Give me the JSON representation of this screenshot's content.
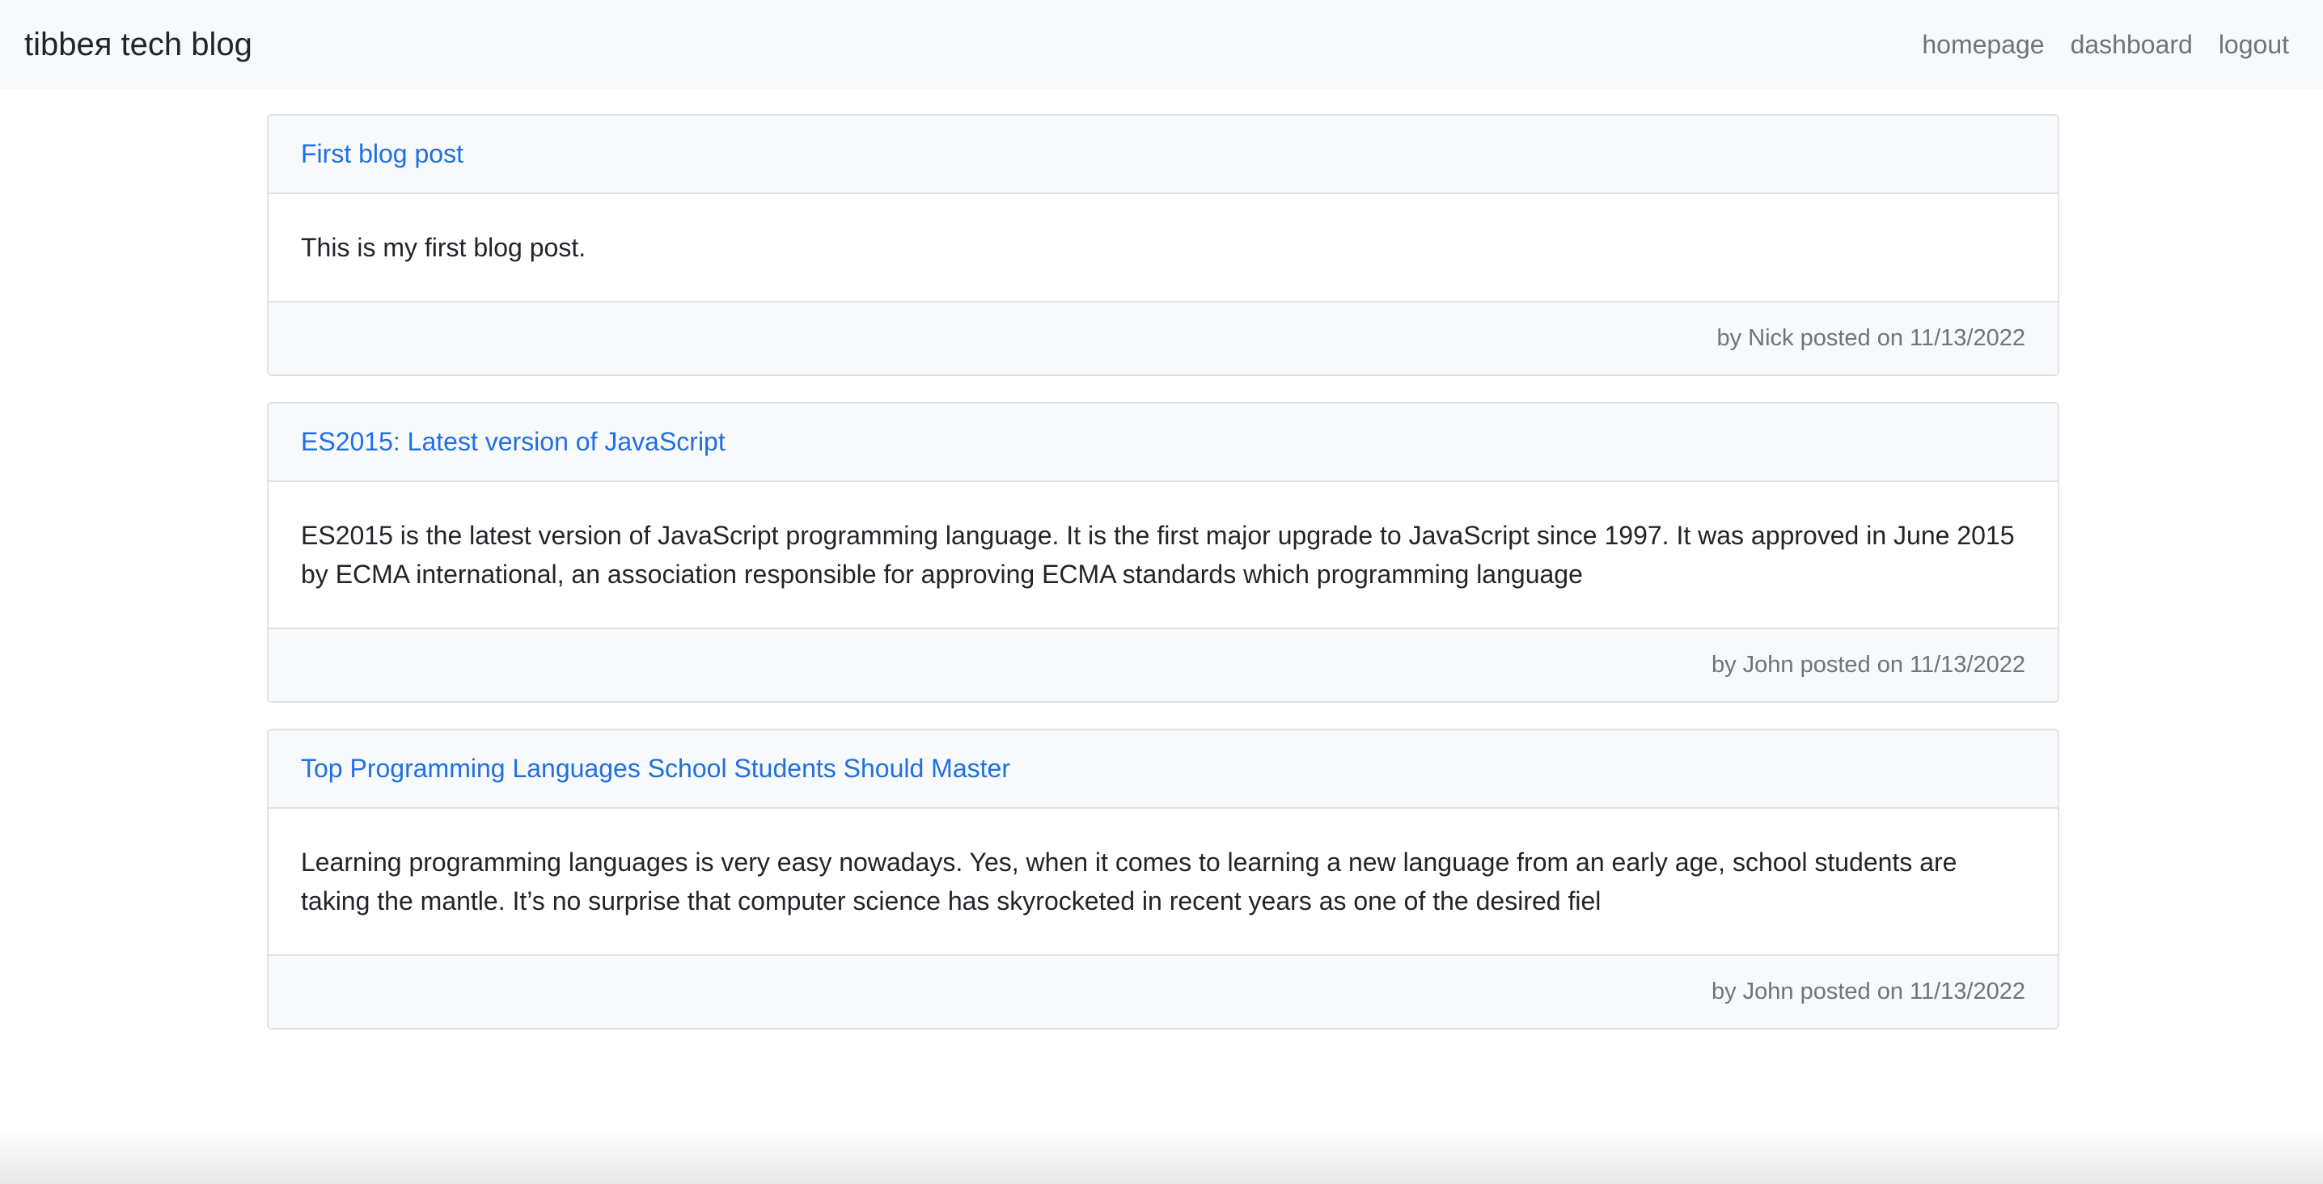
{
  "navbar": {
    "brand": "tibbeя tech blog",
    "links": [
      "homepage",
      "dashboard",
      "logout"
    ]
  },
  "posts": [
    {
      "title": "First blog post",
      "content": "This is my first blog post.",
      "meta": "by Nick posted on 11/13/2022"
    },
    {
      "title": "ES2015: Latest version of JavaScript",
      "content": "ES2015 is the latest version of JavaScript programming language. It is the first major upgrade to JavaScript since 1997. It was approved in June 2015 by ECMA international, an association responsible for approving ECMA standards which programming language",
      "meta": "by John posted on 11/13/2022"
    },
    {
      "title": "Top Programming Languages School Students Should Master",
      "content": "Learning programming languages is very easy nowadays. Yes, when it comes to learning a new language from an early age, school students are taking the mantle. It’s no surprise that computer science has skyrocketed in recent years as one of the desired fiel",
      "meta": "by John posted on 11/13/2022"
    }
  ],
  "colors": {
    "navbar_bg": "#f8f9fa",
    "link": "#1f6fe5",
    "muted": "#6c757d",
    "border": "#dee2e6"
  }
}
